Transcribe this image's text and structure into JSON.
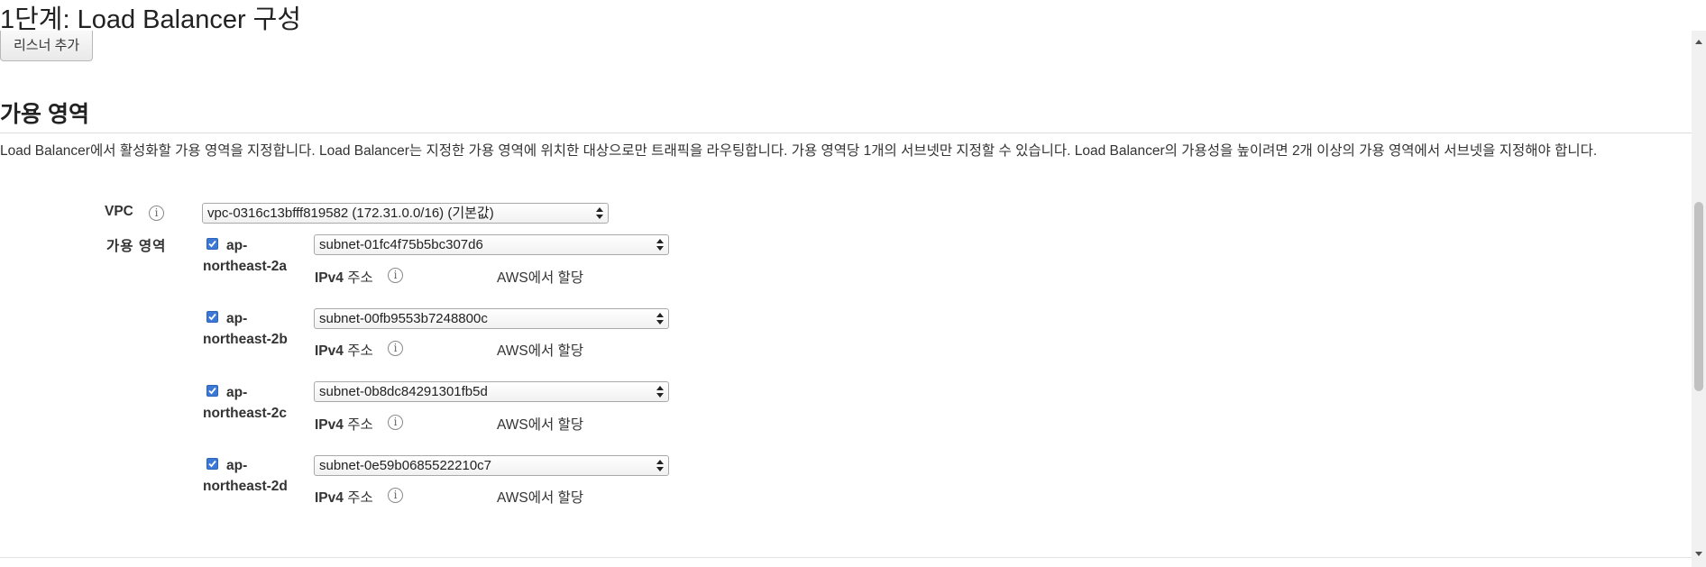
{
  "page": {
    "title": "1단계: Load Balancer 구성",
    "add_listener_label": "리스너 추가"
  },
  "availability_zones": {
    "section_title": "가용 영역",
    "description": "Load Balancer에서 활성화할 가용 영역을 지정합니다. Load Balancer는 지정한 가용 영역에 위치한 대상으로만 트래픽을 라우팅합니다. 가용 영역당 1개의 서브넷만 지정할 수 있습니다. Load Balancer의 가용성을 높이려면 2개 이상의 가용 영역에서 서브넷을 지정해야 합니다.",
    "vpc_label": "VPC",
    "vpc_value": "vpc-0316c13bfff819582 (172.31.0.0/16) (기본값)",
    "az_label": "가용 영역",
    "ipv4_label_bold": "IPv4",
    "ipv4_label_rest": " 주소",
    "zones": [
      {
        "name_line1": "ap-",
        "name_line2": "northeast-2a",
        "checked": true,
        "subnet": "subnet-01fc4f75b5bc307d6",
        "ipv4": "AWS에서 할당"
      },
      {
        "name_line1": "ap-",
        "name_line2": "northeast-2b",
        "checked": true,
        "subnet": "subnet-00fb9553b7248800c",
        "ipv4": "AWS에서 할당"
      },
      {
        "name_line1": "ap-",
        "name_line2": "northeast-2c",
        "checked": true,
        "subnet": "subnet-0b8dc84291301fb5d",
        "ipv4": "AWS에서 할당"
      },
      {
        "name_line1": "ap-",
        "name_line2": "northeast-2d",
        "checked": true,
        "subnet": "subnet-0e59b0685522210c7",
        "ipv4": "AWS에서 할당"
      }
    ]
  },
  "colors": {
    "checkbox": "#3b78d8",
    "text": "#333333"
  }
}
